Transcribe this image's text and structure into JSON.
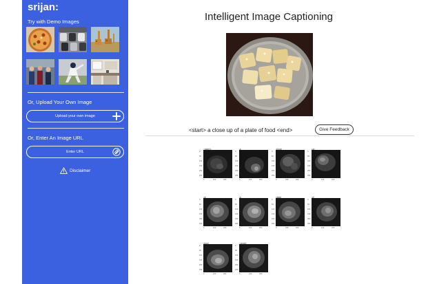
{
  "sidebar": {
    "brand": "srijan:",
    "demo_heading": "Try with Demo Images",
    "demo_images": [
      {
        "icon": "pizza-image"
      },
      {
        "icon": "parked-cars-image"
      },
      {
        "icon": "giraffes-image"
      },
      {
        "icon": "people-crowd-image"
      },
      {
        "icon": "baseball-player-image"
      },
      {
        "icon": "kitchen-image"
      }
    ],
    "upload_heading": "Or, Upload Your Own Image",
    "upload_button": "Upload your own image",
    "url_heading": "Or, Enter An Image URL",
    "url_button": "Enter URL",
    "disclaimer": "Disclaimer"
  },
  "main": {
    "title": "Intelligent Image Captioning",
    "caption": "<start> a close up of a plate of food <end>",
    "feedback_button": "Give Feedback"
  },
  "attention": {
    "yticks": [
      "0",
      "50",
      "100",
      "150",
      "200",
      "250"
    ],
    "xticks": [
      "0",
      "100",
      "200"
    ],
    "maps": [
      {
        "word": "<start>"
      },
      {
        "word": "a"
      },
      {
        "word": "close"
      },
      {
        "word": "up"
      },
      {
        "word": "of"
      },
      {
        "word": "a"
      },
      {
        "word": "plate"
      },
      {
        "word": "of"
      },
      {
        "word": "food"
      },
      {
        "word": "<end>"
      }
    ]
  },
  "colors": {
    "sidebar": "#3b61e0",
    "text": "#222222"
  }
}
